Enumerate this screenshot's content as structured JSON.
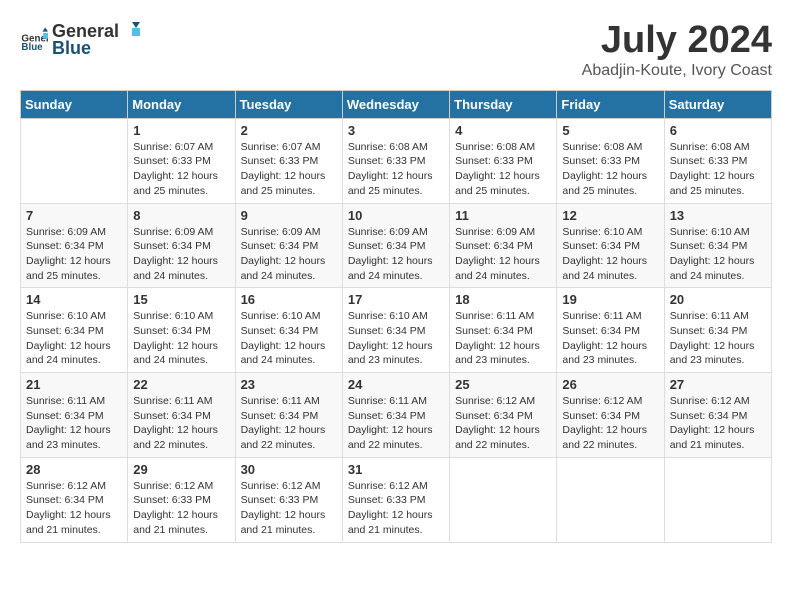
{
  "header": {
    "logo_general": "General",
    "logo_blue": "Blue",
    "month_year": "July 2024",
    "location": "Abadjin-Koute, Ivory Coast"
  },
  "days_of_week": [
    "Sunday",
    "Monday",
    "Tuesday",
    "Wednesday",
    "Thursday",
    "Friday",
    "Saturday"
  ],
  "weeks": [
    [
      {
        "day": "",
        "info": ""
      },
      {
        "day": "1",
        "info": "Sunrise: 6:07 AM\nSunset: 6:33 PM\nDaylight: 12 hours\nand 25 minutes."
      },
      {
        "day": "2",
        "info": "Sunrise: 6:07 AM\nSunset: 6:33 PM\nDaylight: 12 hours\nand 25 minutes."
      },
      {
        "day": "3",
        "info": "Sunrise: 6:08 AM\nSunset: 6:33 PM\nDaylight: 12 hours\nand 25 minutes."
      },
      {
        "day": "4",
        "info": "Sunrise: 6:08 AM\nSunset: 6:33 PM\nDaylight: 12 hours\nand 25 minutes."
      },
      {
        "day": "5",
        "info": "Sunrise: 6:08 AM\nSunset: 6:33 PM\nDaylight: 12 hours\nand 25 minutes."
      },
      {
        "day": "6",
        "info": "Sunrise: 6:08 AM\nSunset: 6:33 PM\nDaylight: 12 hours\nand 25 minutes."
      }
    ],
    [
      {
        "day": "7",
        "info": "Sunrise: 6:09 AM\nSunset: 6:34 PM\nDaylight: 12 hours\nand 25 minutes."
      },
      {
        "day": "8",
        "info": "Sunrise: 6:09 AM\nSunset: 6:34 PM\nDaylight: 12 hours\nand 24 minutes."
      },
      {
        "day": "9",
        "info": "Sunrise: 6:09 AM\nSunset: 6:34 PM\nDaylight: 12 hours\nand 24 minutes."
      },
      {
        "day": "10",
        "info": "Sunrise: 6:09 AM\nSunset: 6:34 PM\nDaylight: 12 hours\nand 24 minutes."
      },
      {
        "day": "11",
        "info": "Sunrise: 6:09 AM\nSunset: 6:34 PM\nDaylight: 12 hours\nand 24 minutes."
      },
      {
        "day": "12",
        "info": "Sunrise: 6:10 AM\nSunset: 6:34 PM\nDaylight: 12 hours\nand 24 minutes."
      },
      {
        "day": "13",
        "info": "Sunrise: 6:10 AM\nSunset: 6:34 PM\nDaylight: 12 hours\nand 24 minutes."
      }
    ],
    [
      {
        "day": "14",
        "info": "Sunrise: 6:10 AM\nSunset: 6:34 PM\nDaylight: 12 hours\nand 24 minutes."
      },
      {
        "day": "15",
        "info": "Sunrise: 6:10 AM\nSunset: 6:34 PM\nDaylight: 12 hours\nand 24 minutes."
      },
      {
        "day": "16",
        "info": "Sunrise: 6:10 AM\nSunset: 6:34 PM\nDaylight: 12 hours\nand 24 minutes."
      },
      {
        "day": "17",
        "info": "Sunrise: 6:10 AM\nSunset: 6:34 PM\nDaylight: 12 hours\nand 23 minutes."
      },
      {
        "day": "18",
        "info": "Sunrise: 6:11 AM\nSunset: 6:34 PM\nDaylight: 12 hours\nand 23 minutes."
      },
      {
        "day": "19",
        "info": "Sunrise: 6:11 AM\nSunset: 6:34 PM\nDaylight: 12 hours\nand 23 minutes."
      },
      {
        "day": "20",
        "info": "Sunrise: 6:11 AM\nSunset: 6:34 PM\nDaylight: 12 hours\nand 23 minutes."
      }
    ],
    [
      {
        "day": "21",
        "info": "Sunrise: 6:11 AM\nSunset: 6:34 PM\nDaylight: 12 hours\nand 23 minutes."
      },
      {
        "day": "22",
        "info": "Sunrise: 6:11 AM\nSunset: 6:34 PM\nDaylight: 12 hours\nand 22 minutes."
      },
      {
        "day": "23",
        "info": "Sunrise: 6:11 AM\nSunset: 6:34 PM\nDaylight: 12 hours\nand 22 minutes."
      },
      {
        "day": "24",
        "info": "Sunrise: 6:11 AM\nSunset: 6:34 PM\nDaylight: 12 hours\nand 22 minutes."
      },
      {
        "day": "25",
        "info": "Sunrise: 6:12 AM\nSunset: 6:34 PM\nDaylight: 12 hours\nand 22 minutes."
      },
      {
        "day": "26",
        "info": "Sunrise: 6:12 AM\nSunset: 6:34 PM\nDaylight: 12 hours\nand 22 minutes."
      },
      {
        "day": "27",
        "info": "Sunrise: 6:12 AM\nSunset: 6:34 PM\nDaylight: 12 hours\nand 21 minutes."
      }
    ],
    [
      {
        "day": "28",
        "info": "Sunrise: 6:12 AM\nSunset: 6:34 PM\nDaylight: 12 hours\nand 21 minutes."
      },
      {
        "day": "29",
        "info": "Sunrise: 6:12 AM\nSunset: 6:33 PM\nDaylight: 12 hours\nand 21 minutes."
      },
      {
        "day": "30",
        "info": "Sunrise: 6:12 AM\nSunset: 6:33 PM\nDaylight: 12 hours\nand 21 minutes."
      },
      {
        "day": "31",
        "info": "Sunrise: 6:12 AM\nSunset: 6:33 PM\nDaylight: 12 hours\nand 21 minutes."
      },
      {
        "day": "",
        "info": ""
      },
      {
        "day": "",
        "info": ""
      },
      {
        "day": "",
        "info": ""
      }
    ]
  ]
}
